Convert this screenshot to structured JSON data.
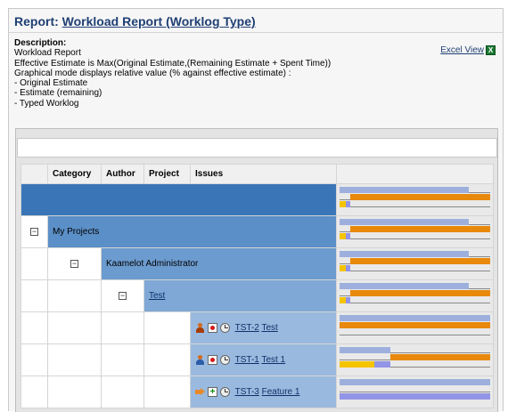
{
  "report": {
    "title_prefix": "Report:",
    "title_link": "Workload Report (Worklog Type)"
  },
  "description": {
    "label": "Description:",
    "lines": [
      "Workload Report",
      "Effective Estimate is Max(Original Estimate,(Remaining Estimate + Spent Time))",
      "Graphical mode displays relative value (% against effective estimate) :",
      "- Original Estimate",
      "- Estimate (remaining)",
      "- Typed Worklog"
    ]
  },
  "excel_view": {
    "label": "Excel View",
    "icon": "excel-icon"
  },
  "table": {
    "headers": [
      "Category",
      "Author",
      "Project",
      "Issues"
    ],
    "rows": [
      {
        "label": "",
        "bars": {
          "original": 0.86,
          "remaining_start": 0.07,
          "remaining": 0.93,
          "worklog_yellow": 0.04,
          "worklog_blue": 0.03
        }
      },
      {
        "label": "My Projects",
        "bars": {
          "original": 0.86,
          "remaining_start": 0.07,
          "remaining": 0.93,
          "worklog_yellow": 0.04,
          "worklog_blue": 0.03
        }
      },
      {
        "label": "Kaamelot Administrator",
        "bars": {
          "original": 0.86,
          "remaining_start": 0.07,
          "remaining": 0.93,
          "worklog_yellow": 0.04,
          "worklog_blue": 0.03
        }
      },
      {
        "label": "Test",
        "bars": {
          "original": 0.86,
          "remaining_start": 0.07,
          "remaining": 0.93,
          "worklog_yellow": 0.04,
          "worklog_blue": 0.03
        }
      },
      {
        "key": "TST-2",
        "summary": "Test",
        "bars": {
          "original": 1.0,
          "remaining_start": 0.0,
          "remaining": 1.0,
          "worklog_yellow": 0.0,
          "worklog_blue": 0.0
        }
      },
      {
        "key": "TST-1",
        "summary": "Test 1",
        "bars": {
          "original": 0.34,
          "remaining_start": 0.34,
          "remaining": 0.66,
          "worklog_yellow": 0.23,
          "worklog_blue": 0.11
        }
      },
      {
        "key": "TST-3",
        "summary": "Feature 1",
        "bars": {
          "original": 1.0,
          "remaining_start": 0.0,
          "remaining": 0.0,
          "worklog_yellow": 0.0,
          "worklog_blue": 1.0
        }
      }
    ]
  },
  "colors": {
    "title_link": "#1f3f74",
    "level1": "#3a76b7",
    "level2": "#5b8fc7",
    "level3": "#6c9bcf",
    "level4": "#7fa8d6",
    "level5": "#9ab9de",
    "original_bar": "#9db0dd",
    "remaining_bar": "#e8890c",
    "worklog_yellow": "#f5c400",
    "worklog_blue": "#9294e6"
  }
}
